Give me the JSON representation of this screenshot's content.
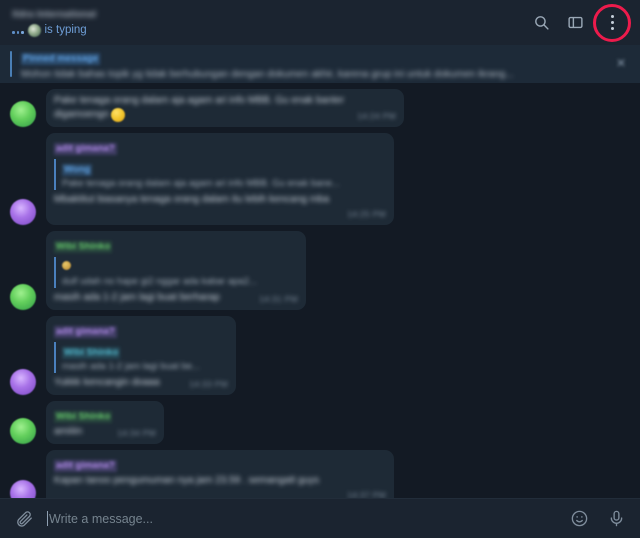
{
  "header": {
    "chat_title": "Xdra International",
    "typing_text": "is typing",
    "icons": {
      "search": "search-icon",
      "panel_toggle": "sidebar-toggle-icon",
      "more_menu": "more-vertical-icon"
    },
    "highlight_color": "#ed1b4c",
    "background": "#1b2430"
  },
  "pinned": {
    "label": "Pinned message",
    "text": "Mohon tidak bahas topik yg tidak berhubungan dengan dokumen akhir, karena grup ini untuk dokumen ikrang...",
    "close_label": "×"
  },
  "chat": {
    "background": "#131a24",
    "bubble_color": "#1e2a36",
    "messages": [
      {
        "id": "m1",
        "avatar": "green",
        "sender": "",
        "quote": null,
        "text_line1": "Pake tenaga orang dalam aja agam ari info MBB. Gu enak banter",
        "text_line2": "digamoengn",
        "emoji": true,
        "time": "14:24 PM"
      },
      {
        "id": "m2",
        "avatar": "purple",
        "sender": "adit gimana?",
        "sender_color": "purple",
        "quote": {
          "name": "Wong",
          "name_color": "blue",
          "text": "Pake tenaga orang dalam aja agam ari info MBB. Gu enak bane..."
        },
        "text_line1": "Mbaktitut biasanya tenaga orang dalam itu lebih kencang mba",
        "time": "14:25 PM"
      },
      {
        "id": "m3",
        "avatar": "green",
        "sender": "Wibi Shinko",
        "sender_color": "green",
        "quote": {
          "name": "",
          "name_color": "teal",
          "text": "dulf udah no hape gi2 nggar ada kabar apa2...",
          "emoji": true
        },
        "text_line1": "masih ada 1-2 jam lagi buat berharap",
        "time": "14:31 PM"
      },
      {
        "id": "m4",
        "avatar": "purple",
        "sender": "adit gimana?",
        "sender_color": "purple",
        "quote": {
          "name": "Wibi Shinko",
          "name_color": "teal",
          "text": "masih ada 1-2 jam lagi buat be..."
        },
        "text_line1": "Yukkk kencangin doaaa",
        "time": "14:33 PM"
      },
      {
        "id": "m5",
        "avatar": "green",
        "sender": "Wibi Shinko",
        "sender_color": "green",
        "quote": null,
        "text_line1": "amiiiin",
        "time": "14:34 PM"
      },
      {
        "id": "m6",
        "avatar": "purple",
        "sender": "adit gimana?",
        "sender_color": "purple",
        "quote": null,
        "text_line1": "Kapan tanoo pengumuman nya jam 23.59 . semangatt guys",
        "time": "14:37 PM"
      }
    ]
  },
  "composer": {
    "attach_icon": "paperclip-icon",
    "placeholder": "Write a message...",
    "emoji_icon": "smiley-icon",
    "mic_icon": "microphone-icon"
  }
}
